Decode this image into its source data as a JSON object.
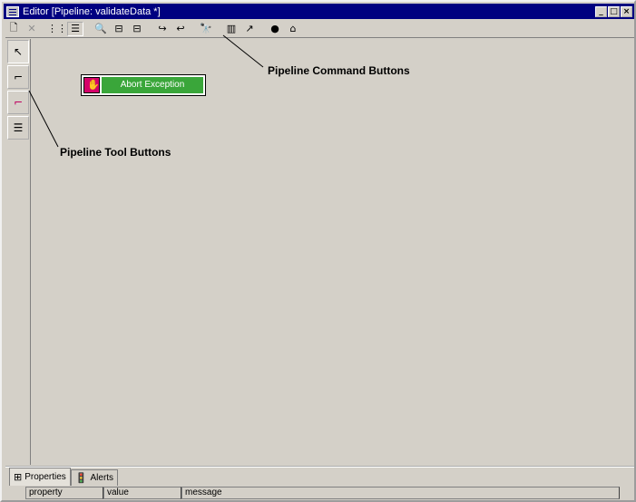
{
  "window": {
    "title": "Editor [Pipeline: validateData *]",
    "minimize_label": "_",
    "maximize_label": "□",
    "close_label": "×"
  },
  "toolbar": {
    "buttons": [
      {
        "name": "new-icon",
        "glyph": "🗋"
      },
      {
        "name": "delete-icon",
        "glyph": "✕"
      },
      {
        "name": "grid-icon",
        "glyph": "⋮⋮"
      },
      {
        "name": "tree-icon",
        "glyph": "☰"
      },
      {
        "name": "zoom-icon",
        "glyph": "🔍"
      },
      {
        "name": "align-left-icon",
        "glyph": "⊟"
      },
      {
        "name": "align-right-icon",
        "glyph": "⊟"
      },
      {
        "name": "step-in-icon",
        "glyph": "↪"
      },
      {
        "name": "step-out-icon",
        "glyph": "↩"
      },
      {
        "name": "find-icon",
        "glyph": "🔭"
      },
      {
        "name": "panel-icon",
        "glyph": "▥"
      },
      {
        "name": "export-icon",
        "glyph": "↗"
      },
      {
        "name": "run-icon",
        "glyph": "●"
      },
      {
        "name": "home-icon",
        "glyph": "⌂"
      }
    ]
  },
  "tools": [
    {
      "name": "select-tool-icon",
      "glyph": "↖"
    },
    {
      "name": "link-tool-icon",
      "glyph": "⌐"
    },
    {
      "name": "branch-tool-icon",
      "glyph": "⌐"
    },
    {
      "name": "list-tool-icon",
      "glyph": "☰"
    }
  ],
  "canvas": {
    "step_label": "Abort Exception"
  },
  "annotations": {
    "command_buttons": "Pipeline Command Buttons",
    "tool_buttons": "Pipeline Tool Buttons"
  },
  "bottom": {
    "tabs": [
      {
        "label": "Properties",
        "icon": "⊞"
      },
      {
        "label": "Alerts",
        "icon": "🚦"
      }
    ],
    "columns": [
      "property",
      "value",
      "message"
    ]
  }
}
